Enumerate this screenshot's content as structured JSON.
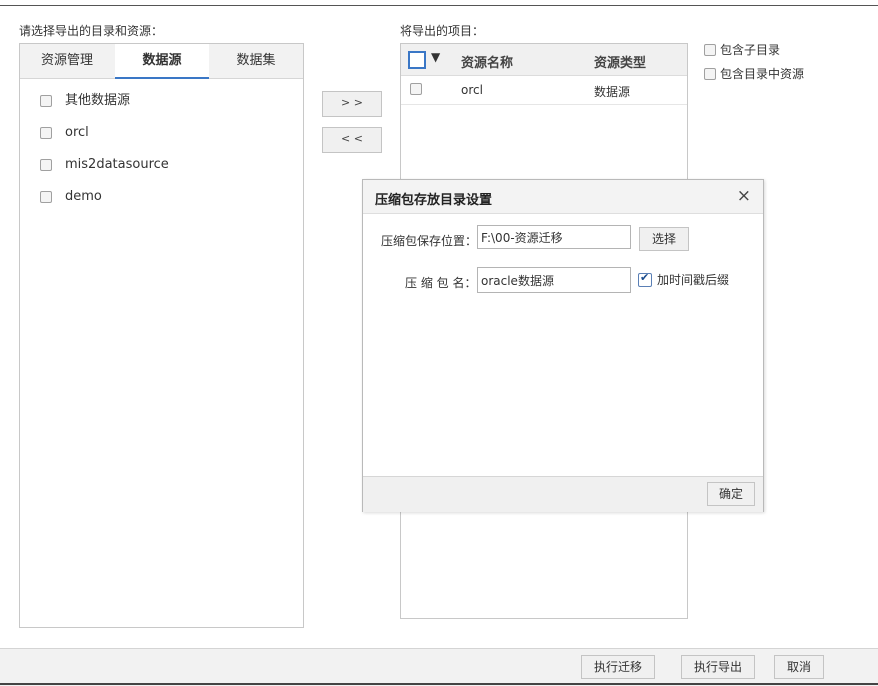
{
  "left": {
    "label": "请选择导出的目录和资源：",
    "tabs": [
      {
        "label": "资源管理"
      },
      {
        "label": "数据源"
      },
      {
        "label": "数据集"
      }
    ],
    "items": [
      {
        "label": "其他数据源"
      },
      {
        "label": "orcl"
      },
      {
        "label": "mis2datasource"
      },
      {
        "label": "demo"
      }
    ]
  },
  "transfer": {
    "add_label": "> >",
    "remove_label": "< <"
  },
  "right": {
    "label": "将导出的项目：",
    "columns": {
      "name": "资源名称",
      "type": "资源类型"
    },
    "rows": [
      {
        "name": "orcl",
        "type": "数据源"
      }
    ]
  },
  "options": {
    "include_subdirs": "包含子目录",
    "include_dir_resources": "包含目录中资源"
  },
  "dialog": {
    "title": "压缩包存放目录设置",
    "close_glyph": "×",
    "path_label": "压缩包保存位置：",
    "path_value": "F:\\00-资源迁移",
    "choose_label": "选择",
    "name_label": "压 缩 包 名：",
    "name_value": "oracle数据源",
    "timestamp_label": "加时间戳后缀",
    "timestamp_checked": true,
    "ok_label": "确定"
  },
  "bottom": {
    "migrate_label": "执行迁移",
    "export_label": "执行导出",
    "cancel_label": "取消"
  }
}
